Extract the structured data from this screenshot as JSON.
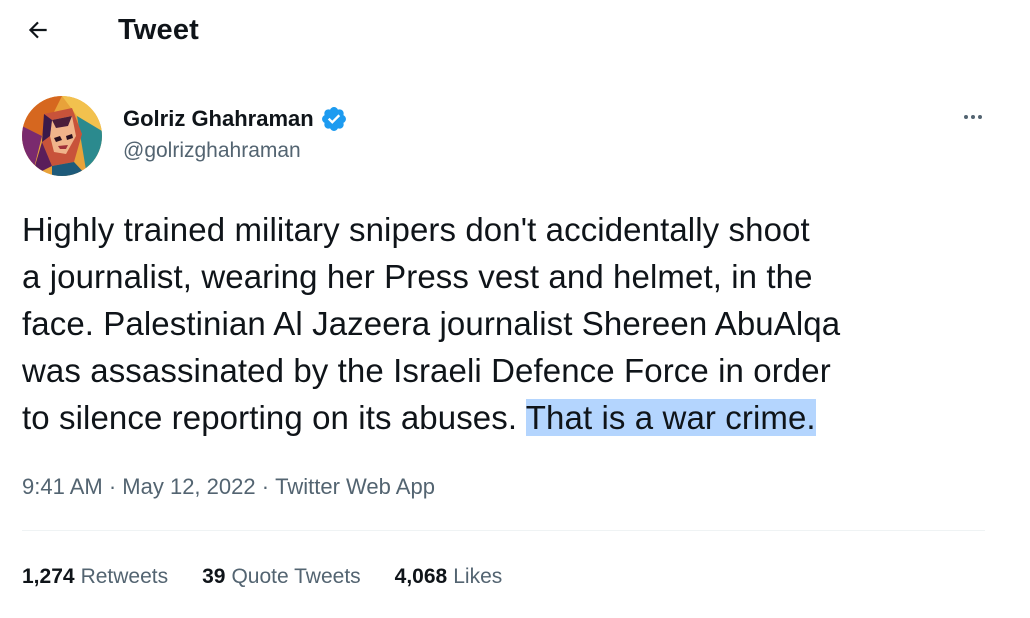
{
  "header": {
    "title": "Tweet",
    "back_icon": "arrow-left-icon"
  },
  "author": {
    "display_name": "Golriz Ghahraman",
    "handle": "@golrizghahraman",
    "verified_icon": "verified-badge-icon",
    "more_icon": "more-horizontal-icon"
  },
  "tweet": {
    "line1": "Highly trained military snipers don't accidentally shoot",
    "line2": "a journalist, wearing her Press vest and helmet, in the",
    "line3": "face. Palestinian Al Jazeera journalist Shereen AbuAlqa",
    "line4": "was assassinated by the Israeli Defence Force in order",
    "line5_pre": "to silence reporting on its abuses. ",
    "line5_highlight": "That is a war crime."
  },
  "meta": {
    "time": "9:41 AM",
    "sep1": " · ",
    "date": "May 12, 2022",
    "sep2": " · ",
    "source": "Twitter Web App"
  },
  "stats": {
    "retweets_count": "1,274",
    "retweets_label": "Retweets",
    "quotes_count": "39",
    "quotes_label": "Quote Tweets",
    "likes_count": "4,068",
    "likes_label": "Likes"
  },
  "colors": {
    "text": "#0f1419",
    "secondary": "#536471",
    "verified": "#1d9bf0",
    "highlight": "#b4d5fe",
    "divider": "#eff3f4"
  }
}
